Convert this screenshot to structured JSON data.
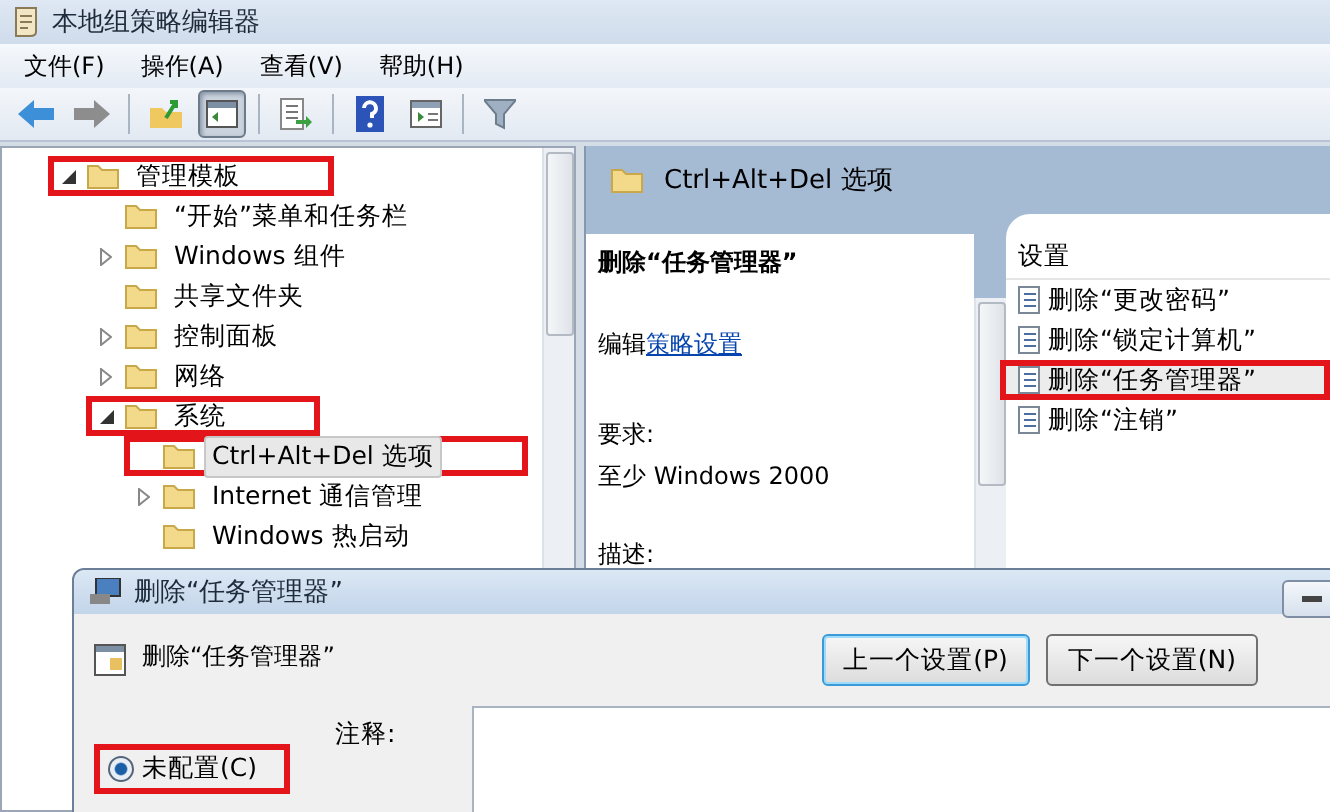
{
  "window": {
    "title": "本地组策略编辑器"
  },
  "menu": [
    {
      "label": "文件(F)"
    },
    {
      "label": "操作(A)"
    },
    {
      "label": "查看(V)"
    },
    {
      "label": "帮助(H)"
    }
  ],
  "toolbar": [
    [
      {
        "kind": "back",
        "pressed": false
      },
      {
        "kind": "forward",
        "pressed": false
      }
    ],
    [
      {
        "kind": "up",
        "pressed": false
      },
      {
        "kind": "tree",
        "pressed": true
      }
    ],
    [
      {
        "kind": "export",
        "pressed": false
      }
    ],
    [
      {
        "kind": "help",
        "pressed": false
      },
      {
        "kind": "pane",
        "pressed": false
      }
    ],
    [
      {
        "kind": "filter",
        "pressed": false
      }
    ]
  ],
  "tree": [
    {
      "label": "管理模板",
      "expandable": true,
      "expanded": true,
      "selected": false,
      "highlighted": true,
      "children": [
        {
          "label": "“开始”菜单和任务栏",
          "expandable": false,
          "selected": false,
          "highlighted": false
        },
        {
          "label": "Windows 组件",
          "expandable": true,
          "expanded": false,
          "selected": false,
          "highlighted": false
        },
        {
          "label": "共享文件夹",
          "expandable": false,
          "selected": false,
          "highlighted": false
        },
        {
          "label": "控制面板",
          "expandable": true,
          "expanded": false,
          "selected": false,
          "highlighted": false
        },
        {
          "label": "网络",
          "expandable": true,
          "expanded": false,
          "selected": false,
          "highlighted": false
        },
        {
          "label": "系统",
          "expandable": true,
          "expanded": true,
          "selected": false,
          "highlighted": true,
          "children": [
            {
              "label": "Ctrl+Alt+Del 选项",
              "expandable": false,
              "selected": true,
              "highlighted": true
            },
            {
              "label": "Internet 通信管理",
              "expandable": true,
              "expanded": false,
              "selected": false,
              "highlighted": false
            },
            {
              "label": "Windows 热启动",
              "expandable": false,
              "selected": false,
              "highlighted": false
            }
          ]
        }
      ]
    }
  ],
  "details": {
    "header": "Ctrl+Alt+Del 选项",
    "title": "删除“任务管理器”",
    "edit_prefix": "编辑",
    "edit_link": "策略设置",
    "requirements_label": "要求:",
    "requirements": "至少 Windows 2000",
    "description_label": "描述:"
  },
  "settings": {
    "column": "设置",
    "items": [
      {
        "label": "删除“更改密码”",
        "selected": false,
        "highlighted": false
      },
      {
        "label": "删除“锁定计算机”",
        "selected": false,
        "highlighted": false
      },
      {
        "label": "删除“任务管理器”",
        "selected": true,
        "highlighted": true
      },
      {
        "label": "删除“注销”",
        "selected": false,
        "highlighted": false
      }
    ]
  },
  "dialog": {
    "title": "删除“任务管理器”",
    "heading": "删除“任务管理器”",
    "buttons": [
      {
        "label": "上一个设置(P)",
        "focused": true
      },
      {
        "label": "下一个设置(N)",
        "focused": false
      }
    ],
    "options": [
      {
        "label": "未配置(C)",
        "selected": true,
        "highlighted": true
      }
    ],
    "comment_label": "注释:"
  }
}
